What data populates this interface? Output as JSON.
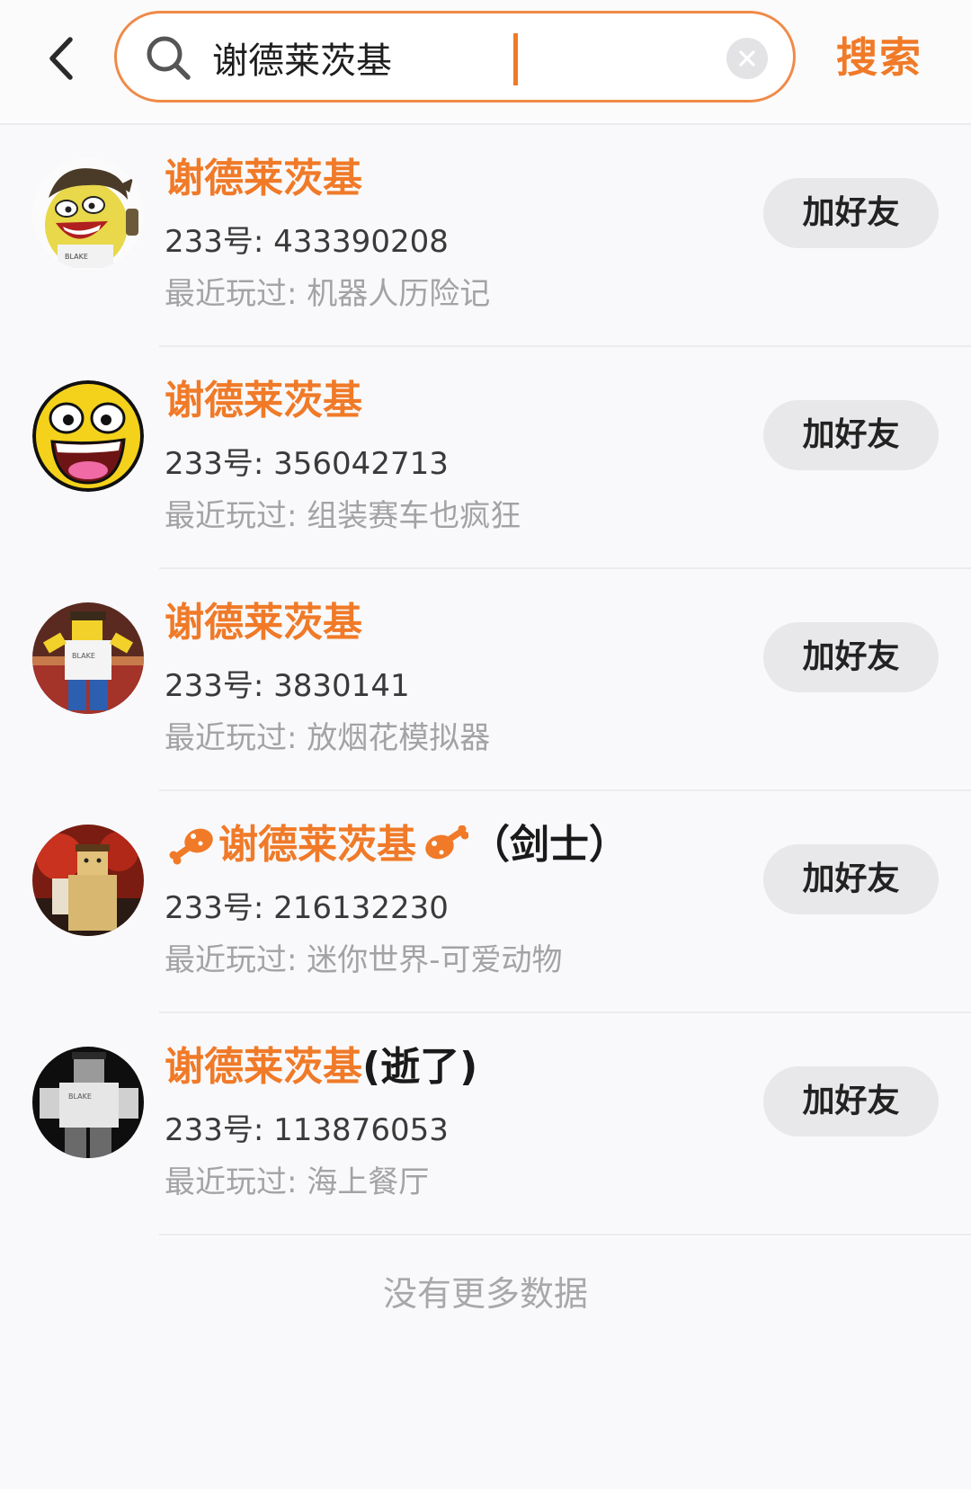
{
  "header": {
    "search_value": "谢德莱茨基",
    "search_button_label": "搜索"
  },
  "results": [
    {
      "name": "谢德莱茨基",
      "name_suffix": "",
      "id_text": "233号: 433390208",
      "recent_text": "最近玩过: 机器人历险记",
      "add_label": "加好友"
    },
    {
      "name": "谢德莱茨基",
      "name_suffix": "",
      "id_text": "233号: 356042713",
      "recent_text": "最近玩过: 组装赛车也疯狂",
      "add_label": "加好友"
    },
    {
      "name": "谢德莱茨基",
      "name_suffix": "",
      "id_text": "233号: 3830141",
      "recent_text": "最近玩过: 放烟花模拟器",
      "add_label": "加好友"
    },
    {
      "name": "谢德莱茨基",
      "name_suffix": "（剑士）",
      "id_text": "233号: 216132230",
      "recent_text": "最近玩过: 迷你世界-可爱动物",
      "add_label": "加好友"
    },
    {
      "name": "谢德莱茨基",
      "name_suffix": "(逝了)",
      "id_text": "233号: 113876053",
      "recent_text": "最近玩过: 海上餐厅",
      "add_label": "加好友"
    }
  ],
  "footer": {
    "no_more_text": "没有更多数据"
  },
  "colors": {
    "accent": "#f07a28",
    "button_bg": "#e8e8eb",
    "secondary_text": "#a3a3a6"
  },
  "icons": {
    "back": "chevron-left-icon",
    "search": "search-icon",
    "clear": "clear-icon",
    "name_decoration": "drumstick-icon"
  }
}
